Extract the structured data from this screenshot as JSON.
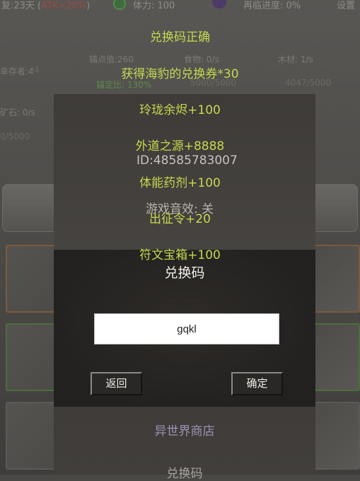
{
  "status_bar": {
    "day_label": "复:23天 (",
    "atk_label": "ATK+20%",
    "day_close": ")",
    "stamina_label": "体力: 100",
    "progress_label": "再临进度: 0%",
    "settings_label": "设置"
  },
  "resources": {
    "survivors": "幸存者:4",
    "survivors_dim": "/4",
    "anchor_value": "锚点值:260",
    "anchor_ratio": "锚定比: 130%",
    "food": "食物: 0/s",
    "food_store": "5000/5000",
    "wood": "木材: 1/s",
    "wood_store": "4047/5000",
    "ore": "矿石: 0/s",
    "ore_store": "0/5000"
  },
  "toasts": [
    "兑换码正确",
    "获得海豹的兑换券*30",
    "玲珑余烬+100",
    "外道之源+8888",
    "体能药剂+100",
    "出征令+20",
    "符文宝箱+100"
  ],
  "settings_menu": {
    "player_id": "ID:48585783007",
    "sound_label": "游戏音效: 关",
    "shop_label": "异世界商店",
    "redeem_label": "兑换码"
  },
  "redeem_dialog": {
    "title": "兑换码",
    "code_value": "gqkl",
    "back_label": "返回",
    "confirm_label": "确定"
  }
}
